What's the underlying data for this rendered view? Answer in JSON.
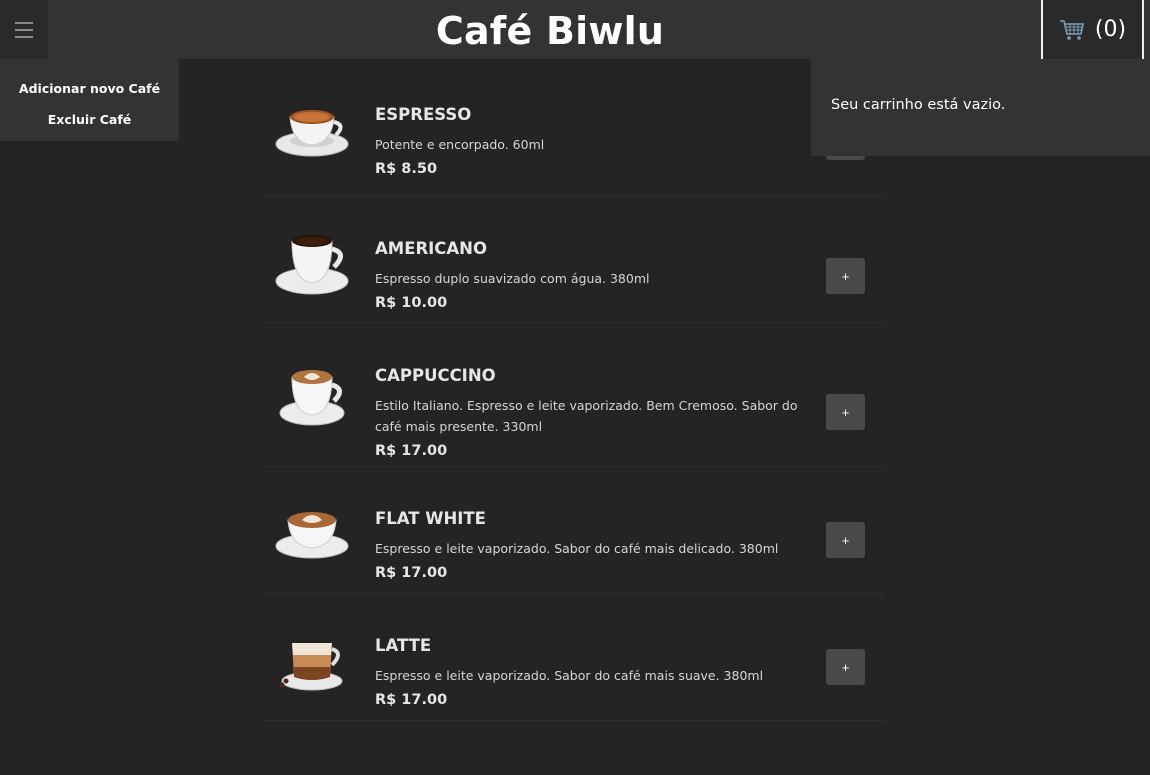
{
  "header": {
    "title": "Café Biwlu",
    "menu_icon": "hamburger-icon",
    "cart_icon": "shopping-cart-icon",
    "cart_count": "(0)"
  },
  "menu": {
    "items": [
      {
        "label": "Adicionar novo Café"
      },
      {
        "label": "Excluir Café"
      }
    ]
  },
  "cart": {
    "empty_message": "Seu carrinho está vazio."
  },
  "products": [
    {
      "name": "ESPRESSO",
      "description": "Potente e encorpado. 60ml",
      "price": "R$ 8.50",
      "add_label": "+"
    },
    {
      "name": "AMERICANO",
      "description": "Espresso duplo suavizado com água. 380ml",
      "price": "R$ 10.00",
      "add_label": "+"
    },
    {
      "name": "CAPPUCCINO",
      "description": "Estilo Italiano. Espresso e leite vaporizado. Bem Cremoso. Sabor do café mais presente. 330ml",
      "price": "R$ 17.00",
      "add_label": "+"
    },
    {
      "name": "FLAT WHITE",
      "description": "Espresso e leite vaporizado. Sabor do café mais delicado. 380ml",
      "price": "R$ 17.00",
      "add_label": "+"
    },
    {
      "name": "LATTE",
      "description": "Espresso e leite vaporizado. Sabor do café mais suave. 380ml",
      "price": "R$ 17.00",
      "add_label": "+"
    }
  ],
  "colors": {
    "background": "#242424",
    "header": "#333333",
    "button": "#4a4a4a"
  }
}
